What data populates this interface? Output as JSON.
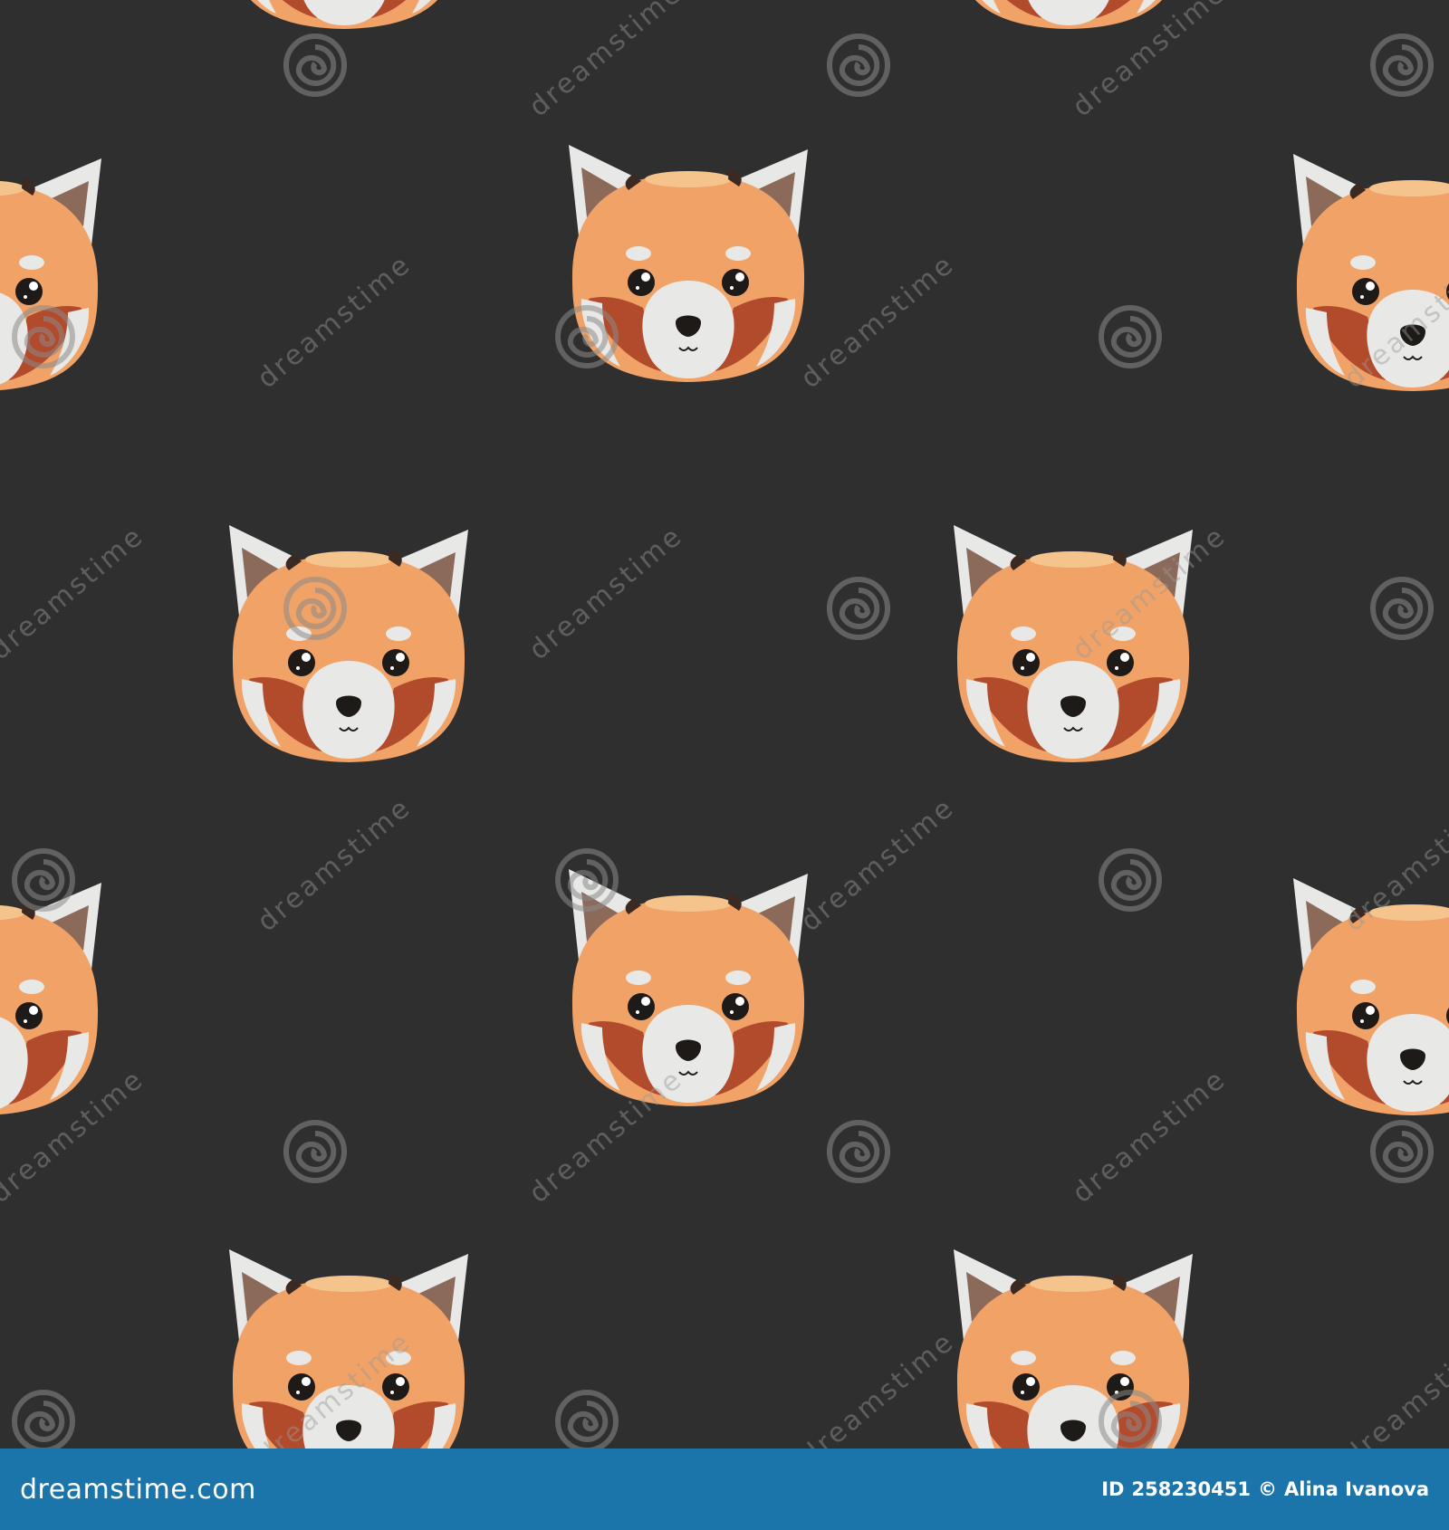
{
  "image": {
    "subject": "red-panda-face-seamless-pattern",
    "background_color": "#2f2f2f",
    "face_color": "#f0a267",
    "cheek_color": "#b24a2c",
    "ear_color": "#e8e8e6",
    "inner_ear_color": "#8b6a5a"
  },
  "watermark": {
    "tile_text": "dreamstime"
  },
  "footer": {
    "brand": "dreamstime.com",
    "id_label": "ID",
    "id_value": "258230451",
    "copyright_symbol": "©",
    "author": "Alina Ivanova",
    "background_color": "#1b75ab"
  }
}
